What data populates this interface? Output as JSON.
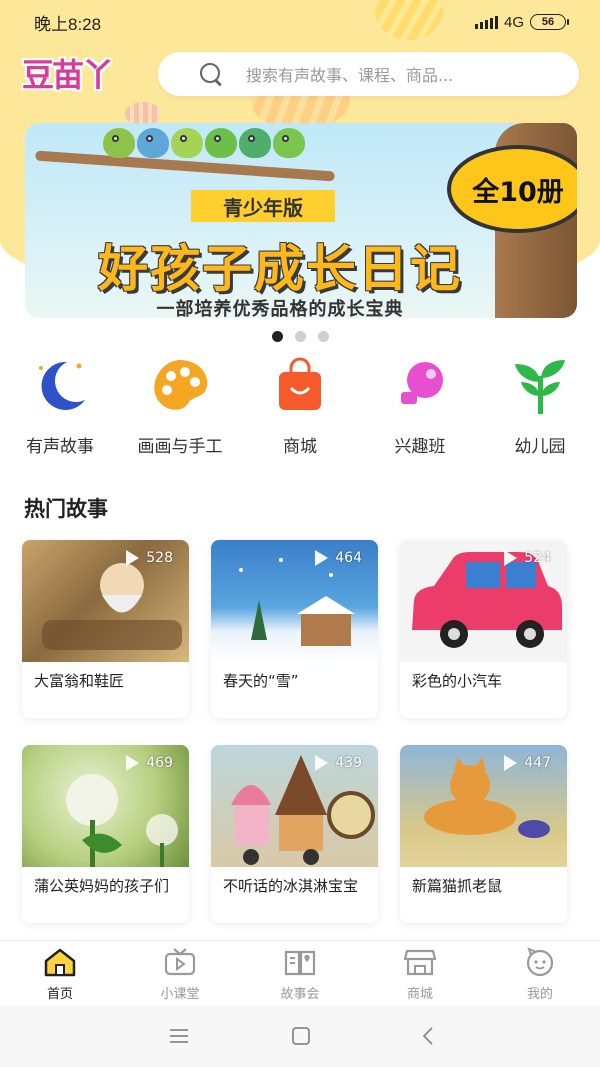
{
  "status_bar": {
    "time": "晚上8:28",
    "network": "4G",
    "battery": "56"
  },
  "header": {
    "logo_text": "豆苗丫",
    "search_placeholder": "搜索有声故事、课程、商品..."
  },
  "banner": {
    "subtitle": "青少年版",
    "title": "好孩子成长日记",
    "badge": "全10册",
    "caption": "一部培养优秀品格的成长宝典",
    "slides": 3,
    "active_slide": 1
  },
  "categories": [
    {
      "label": "有声故事",
      "icon": "moon-icon",
      "color": "#2e52c9"
    },
    {
      "label": "画画与手工",
      "icon": "palette-icon",
      "color": "#f5a623"
    },
    {
      "label": "商城",
      "icon": "shopping-bag-icon",
      "color": "#f45a2a"
    },
    {
      "label": "兴趣班",
      "icon": "whistle-icon",
      "color": "#e84fd0"
    },
    {
      "label": "幼儿园",
      "icon": "sprout-icon",
      "color": "#2fb84a"
    }
  ],
  "section": {
    "title": "热门故事"
  },
  "stories": [
    {
      "title": "大富翁和鞋匠",
      "plays": "528"
    },
    {
      "title": "春天的“雪”",
      "plays": "464"
    },
    {
      "title": "彩色的小汽车",
      "plays": "524"
    },
    {
      "title": "蒲公英妈妈的孩子们",
      "plays": "469"
    },
    {
      "title": "不听话的冰淇淋宝宝",
      "plays": "439"
    },
    {
      "title": "新篇猫抓老鼠",
      "plays": "447"
    }
  ],
  "tabs": [
    {
      "label": "首页",
      "icon": "home-icon",
      "active": true
    },
    {
      "label": "小课堂",
      "icon": "tv-icon",
      "active": false
    },
    {
      "label": "故事会",
      "icon": "book-icon",
      "active": false
    },
    {
      "label": "商城",
      "icon": "store-icon",
      "active": false
    },
    {
      "label": "我的",
      "icon": "face-icon",
      "active": false
    }
  ]
}
